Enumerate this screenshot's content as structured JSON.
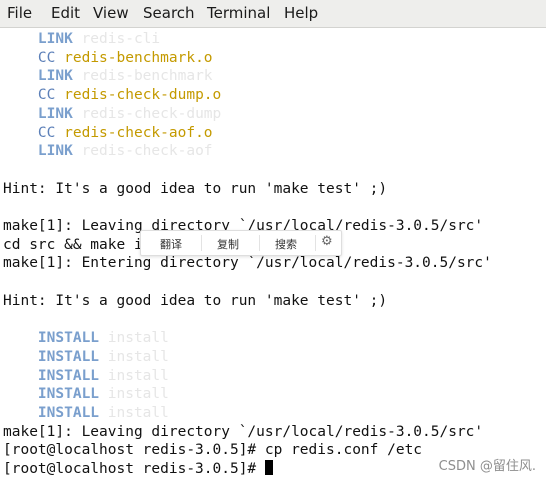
{
  "menubar": {
    "items": [
      "File",
      "Edit",
      "View",
      "Search",
      "Terminal",
      "Help"
    ]
  },
  "terminal": {
    "lines": [
      {
        "kind": "build",
        "tag": "LINK",
        "target": "redis-cli",
        "target_style": "faint"
      },
      {
        "kind": "build",
        "tag": "CC",
        "target": "redis-benchmark.o",
        "target_style": "yellow"
      },
      {
        "kind": "build",
        "tag": "LINK",
        "target": "redis-benchmark",
        "target_style": "faint"
      },
      {
        "kind": "build",
        "tag": "CC",
        "target": "redis-check-dump.o",
        "target_style": "yellow"
      },
      {
        "kind": "build",
        "tag": "LINK",
        "target": "redis-check-dump",
        "target_style": "faint"
      },
      {
        "kind": "build",
        "tag": "CC",
        "target": "redis-check-aof.o",
        "target_style": "yellow"
      },
      {
        "kind": "build",
        "tag": "LINK",
        "target": "redis-check-aof",
        "target_style": "faint"
      },
      {
        "kind": "blank"
      },
      {
        "kind": "text",
        "text": "Hint: It's a good idea to run 'make test' ;)"
      },
      {
        "kind": "blank"
      },
      {
        "kind": "text",
        "text": "make[1]: Leaving directory `/usr/local/redis-3.0.5/src'"
      },
      {
        "kind": "text",
        "text": "cd src && make i"
      },
      {
        "kind": "text",
        "text": "make[1]: Entering directory `/usr/local/redis-3.0.5/src'"
      },
      {
        "kind": "blank"
      },
      {
        "kind": "text",
        "text": "Hint: It's a good idea to run 'make test' ;)"
      },
      {
        "kind": "blank"
      },
      {
        "kind": "build",
        "tag": "INSTALL",
        "target": "install",
        "target_style": "faint"
      },
      {
        "kind": "build",
        "tag": "INSTALL",
        "target": "install",
        "target_style": "faint"
      },
      {
        "kind": "build",
        "tag": "INSTALL",
        "target": "install",
        "target_style": "faint"
      },
      {
        "kind": "build",
        "tag": "INSTALL",
        "target": "install",
        "target_style": "faint"
      },
      {
        "kind": "build",
        "tag": "INSTALL",
        "target": "install",
        "target_style": "faint"
      },
      {
        "kind": "text",
        "text": "make[1]: Leaving directory `/usr/local/redis-3.0.5/src'"
      },
      {
        "kind": "text",
        "text": "[root@localhost redis-3.0.5]# cp redis.conf /etc"
      },
      {
        "kind": "prompt",
        "text": "[root@localhost redis-3.0.5]# "
      }
    ]
  },
  "context_toolbar": {
    "translate_label": "翻译",
    "copy_label": "复制",
    "search_label": "搜索",
    "settings_icon": "gear-icon"
  },
  "watermark": "CSDN @留住风.",
  "colors": {
    "menubar_bg": "#eeeeec",
    "terminal_bg": "#ffffff",
    "text": "#111111",
    "tag_blue": "#7a9fcd",
    "object_yellow": "#c49a00"
  }
}
